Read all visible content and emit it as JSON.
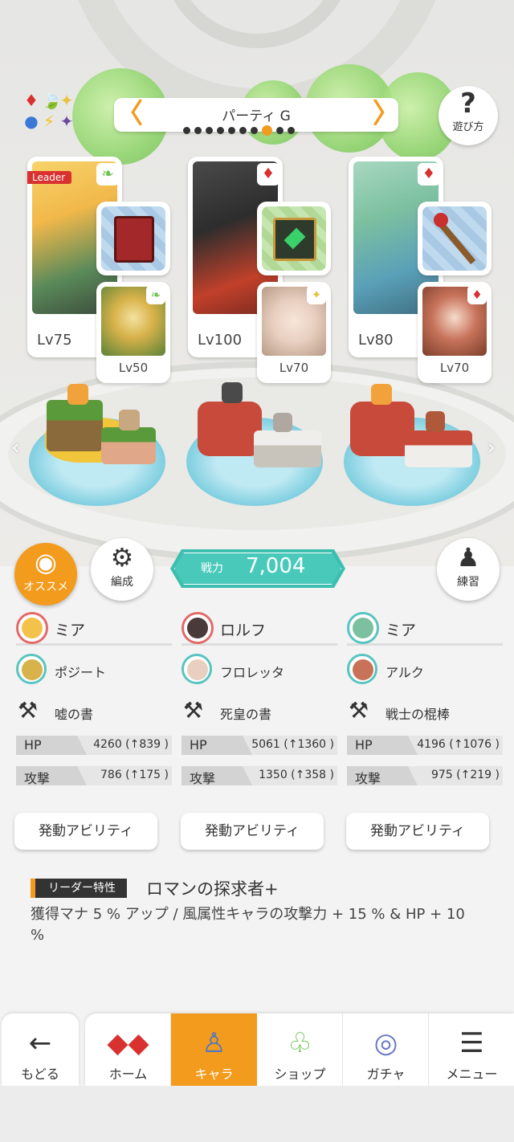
{
  "header": {
    "party_title": "パーティ G",
    "help_label": "遊び方",
    "help_glyph": "?",
    "prev_glyph": "〈",
    "next_glyph": "〉",
    "page_dots_total": 10,
    "page_dot_active": 8
  },
  "element_icons": [
    "♦",
    "🍃",
    "✦",
    "●",
    "⚡",
    "✦"
  ],
  "leader_tag": "Leader",
  "slots": [
    {
      "main_level": "Lv75",
      "sub_level": "Lv50",
      "main_attr_icon": "leaf-icon",
      "sub_attr_icon": "leaf-icon"
    },
    {
      "main_level": "Lv100",
      "sub_level": "Lv70",
      "main_attr_icon": "fire-diamond-icon",
      "sub_attr_icon": "light-star-icon"
    },
    {
      "main_level": "Lv80",
      "sub_level": "Lv70",
      "main_attr_icon": "fire-diamond-icon",
      "sub_attr_icon": "fire-diamond-icon"
    }
  ],
  "buttons": {
    "recommend": "オススメ",
    "formation": "編成",
    "practice": "練習"
  },
  "power": {
    "label": "戦力",
    "value": "7,004"
  },
  "columns": [
    {
      "char": "ミア",
      "sub": "ポジート",
      "weapon": "嘘の書",
      "hp_label": "HP",
      "hp": "4260 (↑839 )",
      "atk_label": "攻撃",
      "atk": "786 (↑175 )",
      "ability": "発動アビリティ"
    },
    {
      "char": "ロルフ",
      "sub": "フロレッタ",
      "weapon": "死皇の書",
      "hp_label": "HP",
      "hp": "5061 (↑1360 )",
      "atk_label": "攻撃",
      "atk": "1350 (↑358 )",
      "ability": "発動アビリティ"
    },
    {
      "char": "ミア",
      "sub": "アルク",
      "weapon": "戦士の棍棒",
      "hp_label": "HP",
      "hp": "4196 (↑1076 )",
      "atk_label": "攻撃",
      "atk": "975 (↑219 )",
      "ability": "発動アビリティ"
    }
  ],
  "leader": {
    "label": "リーダー特性",
    "name": "ロマンの探求者+",
    "desc": "獲得マナ 5 % アップ / 風属性キャラの攻撃力 + 15 % & HP + 10 %"
  },
  "tabbar": {
    "back": "もどる",
    "tabs": [
      "ホーム",
      "キャラ",
      "ショップ",
      "ガチャ",
      "メニュー"
    ],
    "active_index": 1
  },
  "colors": {
    "accent": "#f29b1d",
    "power_teal": "#48c9ba",
    "fire": "#d93030",
    "wind": "#6cbf4e"
  }
}
